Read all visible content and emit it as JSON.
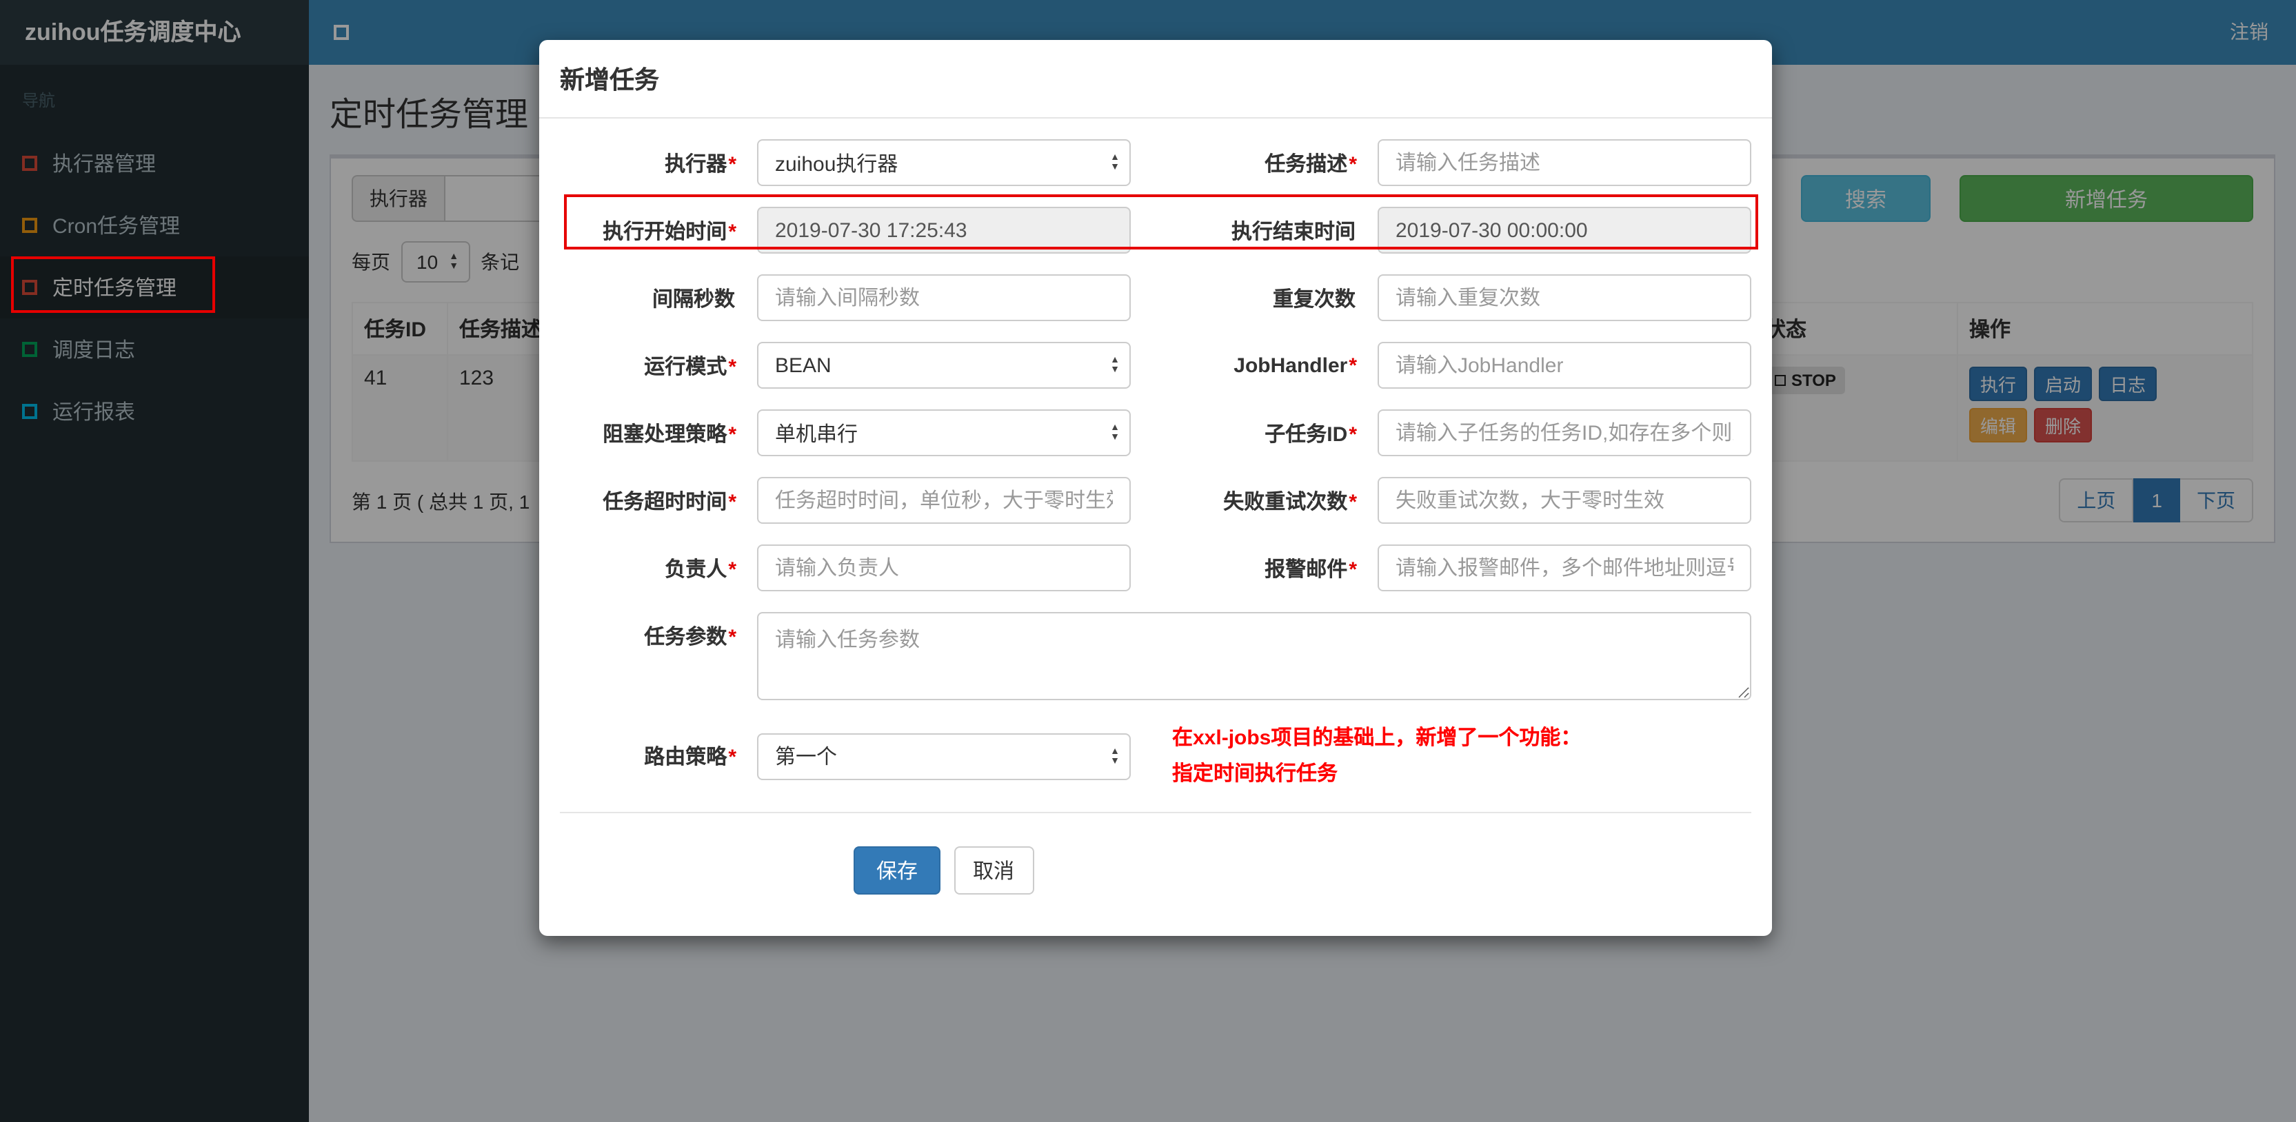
{
  "theme": {
    "navbar_bg": "#3c8dbc",
    "sidebar_bg": "#222d32",
    "content_bg": "#ecf0f5",
    "primary": "#337ab7",
    "search_btn": "#5bc0de",
    "add_btn": "#5cb85c",
    "warning": "#f0ad4e",
    "danger": "#d9534f",
    "annotation_red": "#e60000"
  },
  "navbar": {
    "brand": "zuihou任务调度中心",
    "logout_label": "注销"
  },
  "sidebar": {
    "section_label": "导航",
    "items": [
      {
        "label": "执行器管理",
        "icon_color": "#dd4b39"
      },
      {
        "label": "Cron任务管理",
        "icon_color": "#f39c12"
      },
      {
        "label": "定时任务管理",
        "icon_color": "#dd4b39",
        "active": true
      },
      {
        "label": "调度日志",
        "icon_color": "#00a65a"
      },
      {
        "label": "运行报表",
        "icon_color": "#00c0ef"
      }
    ]
  },
  "page": {
    "title": "定时任务管理"
  },
  "toolbar": {
    "executor_addon": "执行器",
    "search_label": "搜索",
    "add_job_label": "新增任务"
  },
  "perpage": {
    "prefix": "每页",
    "size": "10",
    "suffix": "条记"
  },
  "job_table": {
    "headers": {
      "job_id": "任务ID",
      "job_desc": "任务描述",
      "status": "状态",
      "actions": "操作"
    },
    "row": {
      "job_id": "41",
      "job_desc": "123",
      "status": "STOP",
      "action_execute": "执行",
      "action_start": "启动",
      "action_log": "日志",
      "action_edit": "编辑",
      "action_delete": "删除"
    }
  },
  "pagination": {
    "info": "第 1 页 ( 总共 1 页, 1",
    "prev_label": "上页",
    "current_page": "1",
    "next_label": "下页"
  },
  "modal": {
    "title": "新增任务",
    "form": {
      "executor": {
        "label": "执行器",
        "star": "*",
        "value": "zuihou执行器"
      },
      "job_desc": {
        "label": "任务描述",
        "star": "*",
        "placeholder": "请输入任务描述"
      },
      "start_time": {
        "label": "执行开始时间",
        "star": "*",
        "value": "2019-07-30 17:25:43"
      },
      "end_time": {
        "label": "执行结束时间",
        "star": "",
        "value": "2019-07-30 00:00:00"
      },
      "interval_seconds": {
        "label": "间隔秒数",
        "star": "",
        "placeholder": "请输入间隔秒数"
      },
      "repeat_count": {
        "label": "重复次数",
        "star": "",
        "placeholder": "请输入重复次数"
      },
      "run_mode": {
        "label": "运行模式",
        "star": "*",
        "value": "BEAN"
      },
      "job_handler": {
        "label": "JobHandler",
        "star": "*",
        "placeholder": "请输入JobHandler"
      },
      "block_strategy": {
        "label": "阻塞处理策略",
        "star": "*",
        "value": "单机串行"
      },
      "child_job_id": {
        "label": "子任务ID",
        "star": "*",
        "placeholder": "请输入子任务的任务ID,如存在多个则逗"
      },
      "timeout": {
        "label": "任务超时时间",
        "star": "*",
        "placeholder": "任务超时时间，单位秒，大于零时生效"
      },
      "fail_retry": {
        "label": "失败重试次数",
        "star": "*",
        "placeholder": "失败重试次数，大于零时生效"
      },
      "owner": {
        "label": "负责人",
        "star": "*",
        "placeholder": "请输入负责人"
      },
      "alarm_email": {
        "label": "报警邮件",
        "star": "*",
        "placeholder": "请输入报警邮件，多个邮件地址则逗号分"
      },
      "job_param": {
        "label": "任务参数",
        "star": "*",
        "placeholder": "请输入任务参数"
      },
      "route_strategy": {
        "label": "路由策略",
        "star": "*",
        "value": "第一个"
      }
    },
    "note_line1": "在xxl-jobs项目的基础上，新增了一个功能：",
    "note_line2": "指定时间执行任务",
    "save_label": "保存",
    "cancel_label": "取消"
  }
}
